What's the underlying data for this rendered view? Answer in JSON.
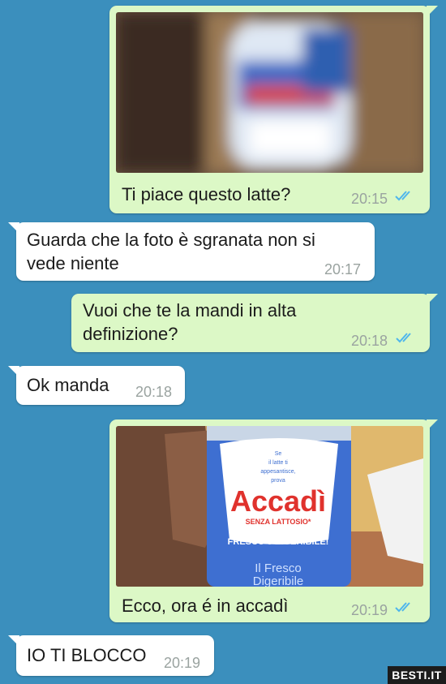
{
  "messages": [
    {
      "dir": "out",
      "kind": "image",
      "caption": "Ti piace questo latte?",
      "time": "20:15",
      "read": true
    },
    {
      "dir": "in",
      "kind": "text",
      "text": "Guarda che la foto è sgranata non si\nvede niente",
      "time": "20:17"
    },
    {
      "dir": "out",
      "kind": "text",
      "text": "Vuoi che te la mandi in alta\ndefinizione?",
      "time": "20:18",
      "read": true
    },
    {
      "dir": "in",
      "kind": "text",
      "text": "Ok manda",
      "time": "20:18"
    },
    {
      "dir": "out",
      "kind": "image",
      "caption": "Ecco, ora é in accadì",
      "time": "20:19",
      "read": true
    },
    {
      "dir": "in",
      "kind": "text",
      "text": "IO TI BLOCCO",
      "time": "20:19"
    }
  ],
  "product_label": {
    "top_text": "Se\nil latte ti\nappesantisce,\nprova",
    "brand": "Accadì",
    "subtitle": "SENZA LATTOSIO*",
    "claim": "FRESCO e DIGERIBILE!",
    "bottom_text": "Il Fresco\nDigeribile"
  },
  "watermark": "BESTI.IT",
  "colors": {
    "background": "#3b8fbd",
    "outgoing": "#dcf8c6",
    "incoming": "#ffffff",
    "read_ticks": "#4fb6ec"
  }
}
